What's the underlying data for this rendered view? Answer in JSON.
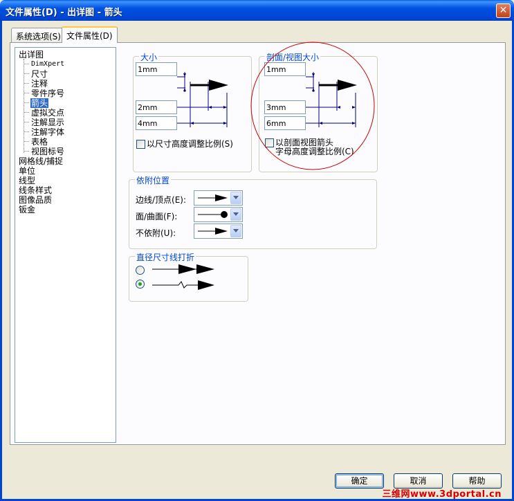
{
  "window": {
    "title": "文件属性(D) - 出详图 - 箭头",
    "close_glyph": "✕"
  },
  "tabs": [
    {
      "label": "系统选项(S)"
    },
    {
      "label": "文件属性(D)"
    }
  ],
  "tree": {
    "items": [
      {
        "label": "出详图"
      },
      {
        "label": "DimXpert"
      },
      {
        "label": "尺寸"
      },
      {
        "label": "注释"
      },
      {
        "label": "零件序号"
      },
      {
        "label": "箭头"
      },
      {
        "label": "虚拟交点"
      },
      {
        "label": "注解显示"
      },
      {
        "label": "注解字体"
      },
      {
        "label": "表格"
      },
      {
        "label": "视图标号"
      },
      {
        "label": "网格线/捕捉"
      },
      {
        "label": "单位"
      },
      {
        "label": "线型"
      },
      {
        "label": "线条样式"
      },
      {
        "label": "图像品质"
      },
      {
        "label": "钣金"
      }
    ]
  },
  "size_group": {
    "legend": "大小",
    "height": "1mm",
    "width": "2mm",
    "length": "4mm",
    "scale_checkbox": "以尺寸高度调整比例(S)"
  },
  "section_group": {
    "legend": "剖面/视图大小",
    "height": "1mm",
    "width": "3mm",
    "length": "6mm",
    "scale_checkbox_line1": "以剖面视图箭头",
    "scale_checkbox_line2": "字母高度调整比例(C)"
  },
  "attach_group": {
    "legend": "依附位置",
    "rows": [
      {
        "label": "边线/顶点(E):",
        "style": "filled-arrow"
      },
      {
        "label": "面/曲面(F):",
        "style": "dot"
      },
      {
        "label": "不依附(U):",
        "style": "filled-arrow"
      }
    ]
  },
  "diameter_group": {
    "legend": "直径尺寸线打折",
    "options": [
      {
        "style": "straight",
        "selected": false
      },
      {
        "style": "jogged",
        "selected": true
      }
    ]
  },
  "buttons": {
    "ok": "确定",
    "cancel": "取消",
    "help": "帮助"
  },
  "watermark": "三维网www.3dportal.cn",
  "colors": {
    "accent": "#0046d5",
    "selection": "#316ac5",
    "annotation_circle": "#cc0000"
  }
}
